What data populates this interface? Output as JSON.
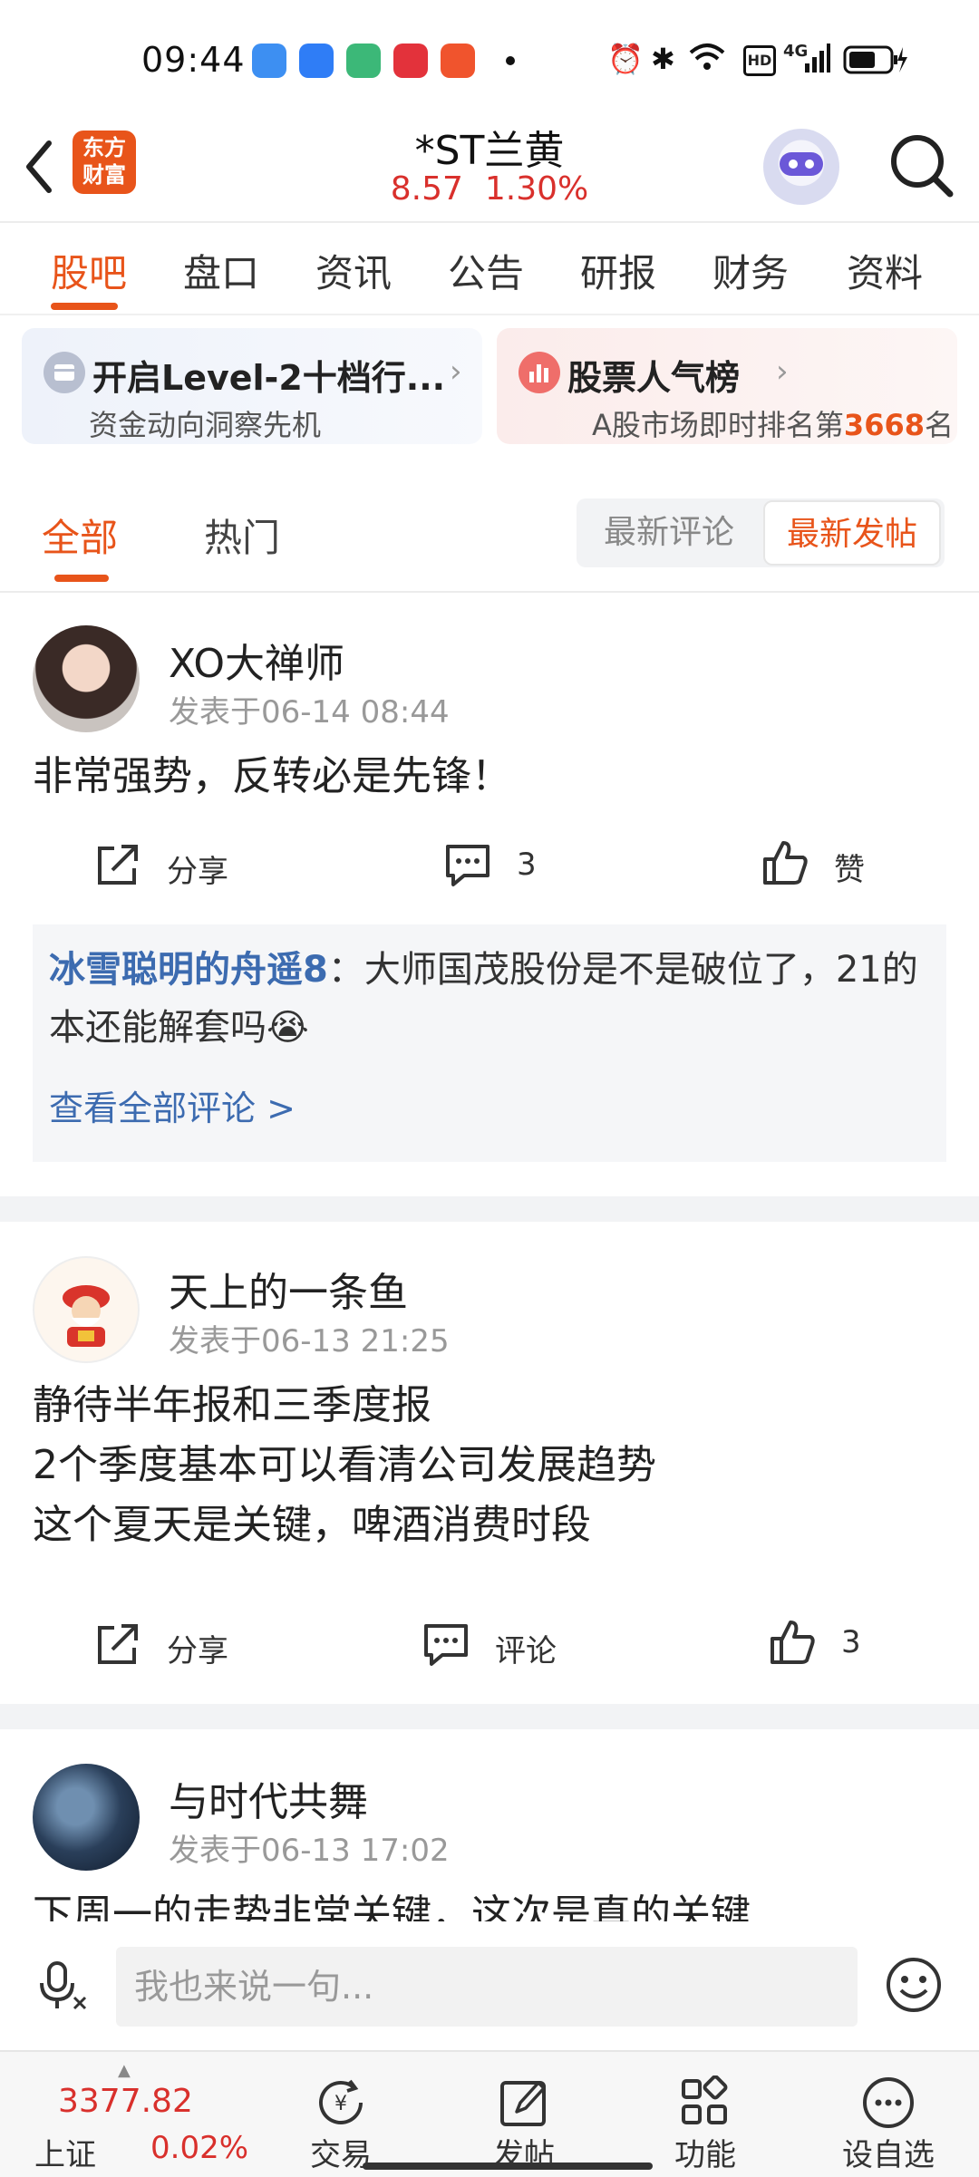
{
  "status_bar": {
    "time": "09:44",
    "battery_icon": "battery-icon",
    "signal": "4G",
    "hd": "HD"
  },
  "header": {
    "logo_text_1": "东方",
    "logo_text_2": "财富",
    "stock_name": "*ST兰黄",
    "price": "8.57",
    "change_pct": "1.30%",
    "accent_color": "#e8541a",
    "up_color": "#d9302c"
  },
  "tabs": [
    "股吧",
    "盘口",
    "资讯",
    "公告",
    "研报",
    "财务",
    "资料"
  ],
  "banners": {
    "level2": {
      "title": "开启Level-2十档行...",
      "subtitle": "资金动向洞察先机"
    },
    "popularity": {
      "title": "股票人气榜",
      "subtitle_prefix": "A股市场即时排名第",
      "rank": "3668",
      "subtitle_suffix": "名"
    }
  },
  "filters": {
    "all": "全部",
    "hot": "热门",
    "sort_comment": "最新评论",
    "sort_post": "最新发帖"
  },
  "posts": [
    {
      "username": "XO大禅师",
      "date": "发表于06-14 08:44",
      "lines": [
        "非常强势，反转必是先锋！"
      ],
      "share": "分享",
      "comments": "3",
      "likes": "赞",
      "top_comment": {
        "user": "冰雪聪明的舟遥8",
        "text": "：大师国茂股份是不是破位了，21的本还能解套吗😭",
        "view_all": "查看全部评论 >"
      }
    },
    {
      "username": "天上的一条鱼",
      "date": "发表于06-13 21:25",
      "lines": [
        "静待半年报和三季度报",
        "2个季度基本可以看清公司发展趋势",
        "这个夏天是关键，啤酒消费时段"
      ],
      "share": "分享",
      "comments": "评论",
      "likes": "3"
    },
    {
      "username": "与时代共舞",
      "date": "发表于06-13 17:02",
      "lines": [
        "下周一的走势非常关键，这次是真的关键"
      ]
    }
  ],
  "input": {
    "placeholder": "我也来说一句..."
  },
  "bottom_nav": {
    "index_value": "3377.82",
    "index_name": "上证",
    "index_change": "0.02%",
    "items": [
      "交易",
      "发帖",
      "功能",
      "设自选"
    ]
  }
}
